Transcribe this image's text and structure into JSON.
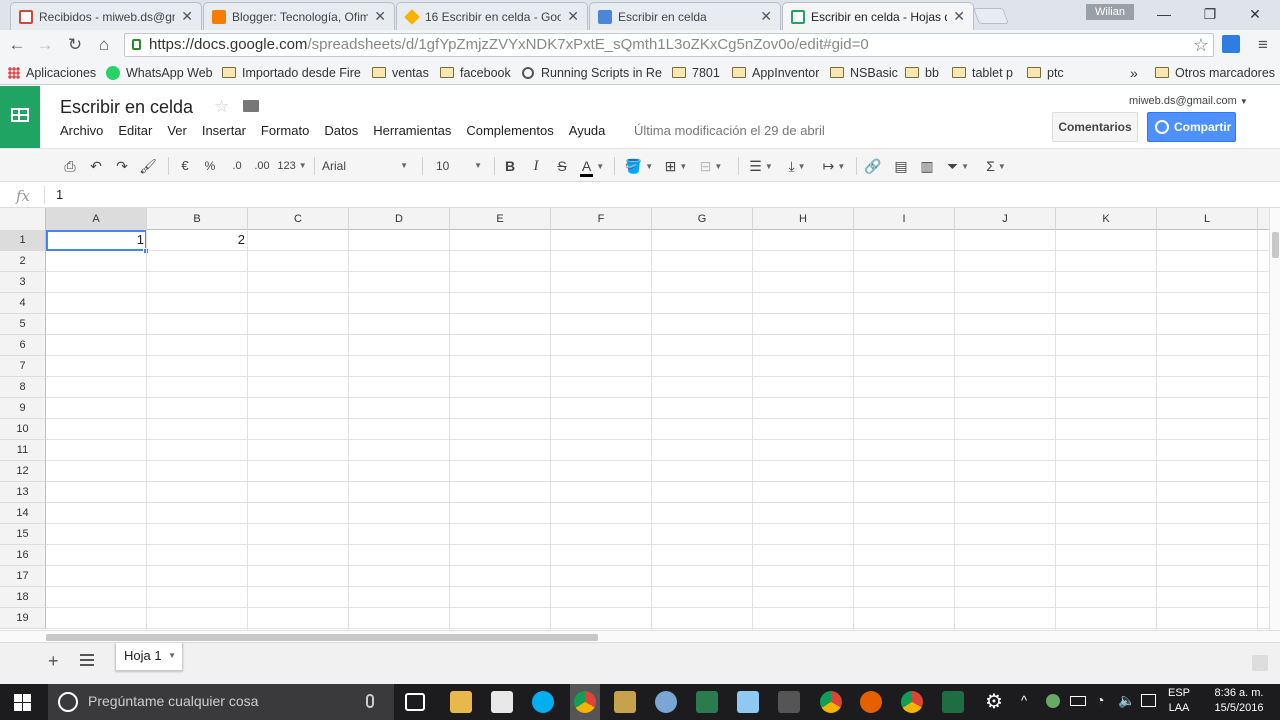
{
  "browser": {
    "tabs": [
      {
        "title": "Recibidos - miweb.ds@gm",
        "favicon_color": "#d44638"
      },
      {
        "title": "Blogger: Tecnología, Ofim",
        "favicon_color": "#f57d00"
      },
      {
        "title": "16 Escribir en celda - Goo",
        "favicon_color": "#f4b400"
      },
      {
        "title": "Escribir en celda",
        "favicon_color": "#4a87d8"
      },
      {
        "title": "Escribir en celda - Hojas d",
        "favicon_color": "#1fa463"
      }
    ],
    "user": "Wilian",
    "url_main": "https://docs.google.com",
    "url_path": "/spreadsheets/d/1gfYpZmjzZVYxNDK7xPxtE_sQmth1L3oZKxCg5nZov0o/edit#gid=0",
    "bookmarks": [
      {
        "label": "Aplicaciones",
        "icon": "apps-icon"
      },
      {
        "label": "WhatsApp Web",
        "icon": "whatsapp-icon"
      },
      {
        "label": "Importado desde Fire",
        "icon": "folder-icon"
      },
      {
        "label": "ventas",
        "icon": "folder-icon"
      },
      {
        "label": "facebook",
        "icon": "folder-icon"
      },
      {
        "label": "Running Scripts in Re",
        "icon": "page-icon"
      },
      {
        "label": "7801",
        "icon": "folder-icon"
      },
      {
        "label": "AppInventor",
        "icon": "folder-icon"
      },
      {
        "label": "NSBasic",
        "icon": "folder-icon"
      },
      {
        "label": "bb",
        "icon": "folder-icon"
      },
      {
        "label": "tablet p",
        "icon": "folder-icon"
      },
      {
        "label": "ptc",
        "icon": "folder-icon"
      }
    ],
    "more_bookmarks": "»",
    "other_bookmarks": "Otros marcadores"
  },
  "doc": {
    "title": "Escribir en celda",
    "menus": [
      "Archivo",
      "Editar",
      "Ver",
      "Insertar",
      "Formato",
      "Datos",
      "Herramientas",
      "Complementos",
      "Ayuda"
    ],
    "last_modified": "Última modificación el 29 de abril",
    "account": "miweb.ds@gmail.com",
    "comments_label": "Comentarios",
    "share_label": "Compartir"
  },
  "toolbar": {
    "currency": "€",
    "percent": "%",
    "dec_decrease": ".0",
    "dec_increase": ".00",
    "number_format": "123",
    "font": "Arial",
    "font_size": "10",
    "bold": "B",
    "italic": "I",
    "strike": "S",
    "text_color": "A"
  },
  "formula": {
    "fx": "fx",
    "value": "1"
  },
  "sheet": {
    "columns": [
      "A",
      "B",
      "C",
      "D",
      "E",
      "F",
      "G",
      "H",
      "I",
      "J",
      "K",
      "L"
    ],
    "rows": [
      "1",
      "2",
      "3",
      "4",
      "5",
      "6",
      "7",
      "8",
      "9",
      "10",
      "11",
      "12",
      "13",
      "14",
      "15",
      "16",
      "17",
      "18",
      "19"
    ],
    "cells": [
      {
        "ref": "A1",
        "value": "1"
      },
      {
        "ref": "B1",
        "value": "2"
      }
    ],
    "selected": "A1",
    "tab_name": "Hoja 1"
  },
  "taskbar": {
    "search_placeholder": "Pregúntame cualquier cosa",
    "lang_top": "ESP",
    "lang_bottom": "LAA",
    "time": "8:36 a. m.",
    "date": "15/5/2016"
  }
}
